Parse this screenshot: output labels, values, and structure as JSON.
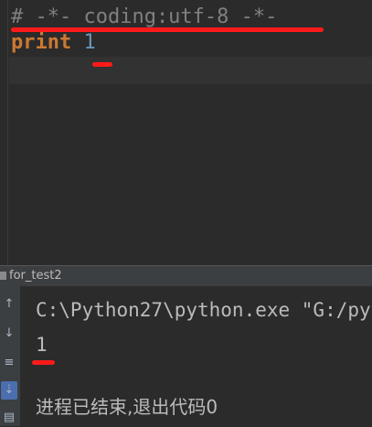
{
  "editor": {
    "line1": "# -*- coding:utf-8 -*-",
    "line2_keyword": "print",
    "line2_value": "1"
  },
  "run_panel": {
    "title": "for_test2",
    "toolbar": [
      {
        "icon": "arrow-up-icon",
        "glyph": "↑"
      },
      {
        "icon": "arrow-down-icon",
        "glyph": "↓"
      },
      {
        "icon": "soft-wrap-icon",
        "glyph": "≡"
      },
      {
        "icon": "scroll-to-end-icon",
        "glyph": "⇣"
      },
      {
        "icon": "print-icon",
        "glyph": "▤"
      }
    ],
    "console": {
      "command": "C:\\Python27\\python.exe \"G:/py",
      "output": "1",
      "exit_message": "进程已结束,退出代码0"
    }
  },
  "colors": {
    "annotation": "#ff1a1a",
    "keyword": "#cc7832",
    "number": "#6897bb",
    "comment": "#808080"
  }
}
